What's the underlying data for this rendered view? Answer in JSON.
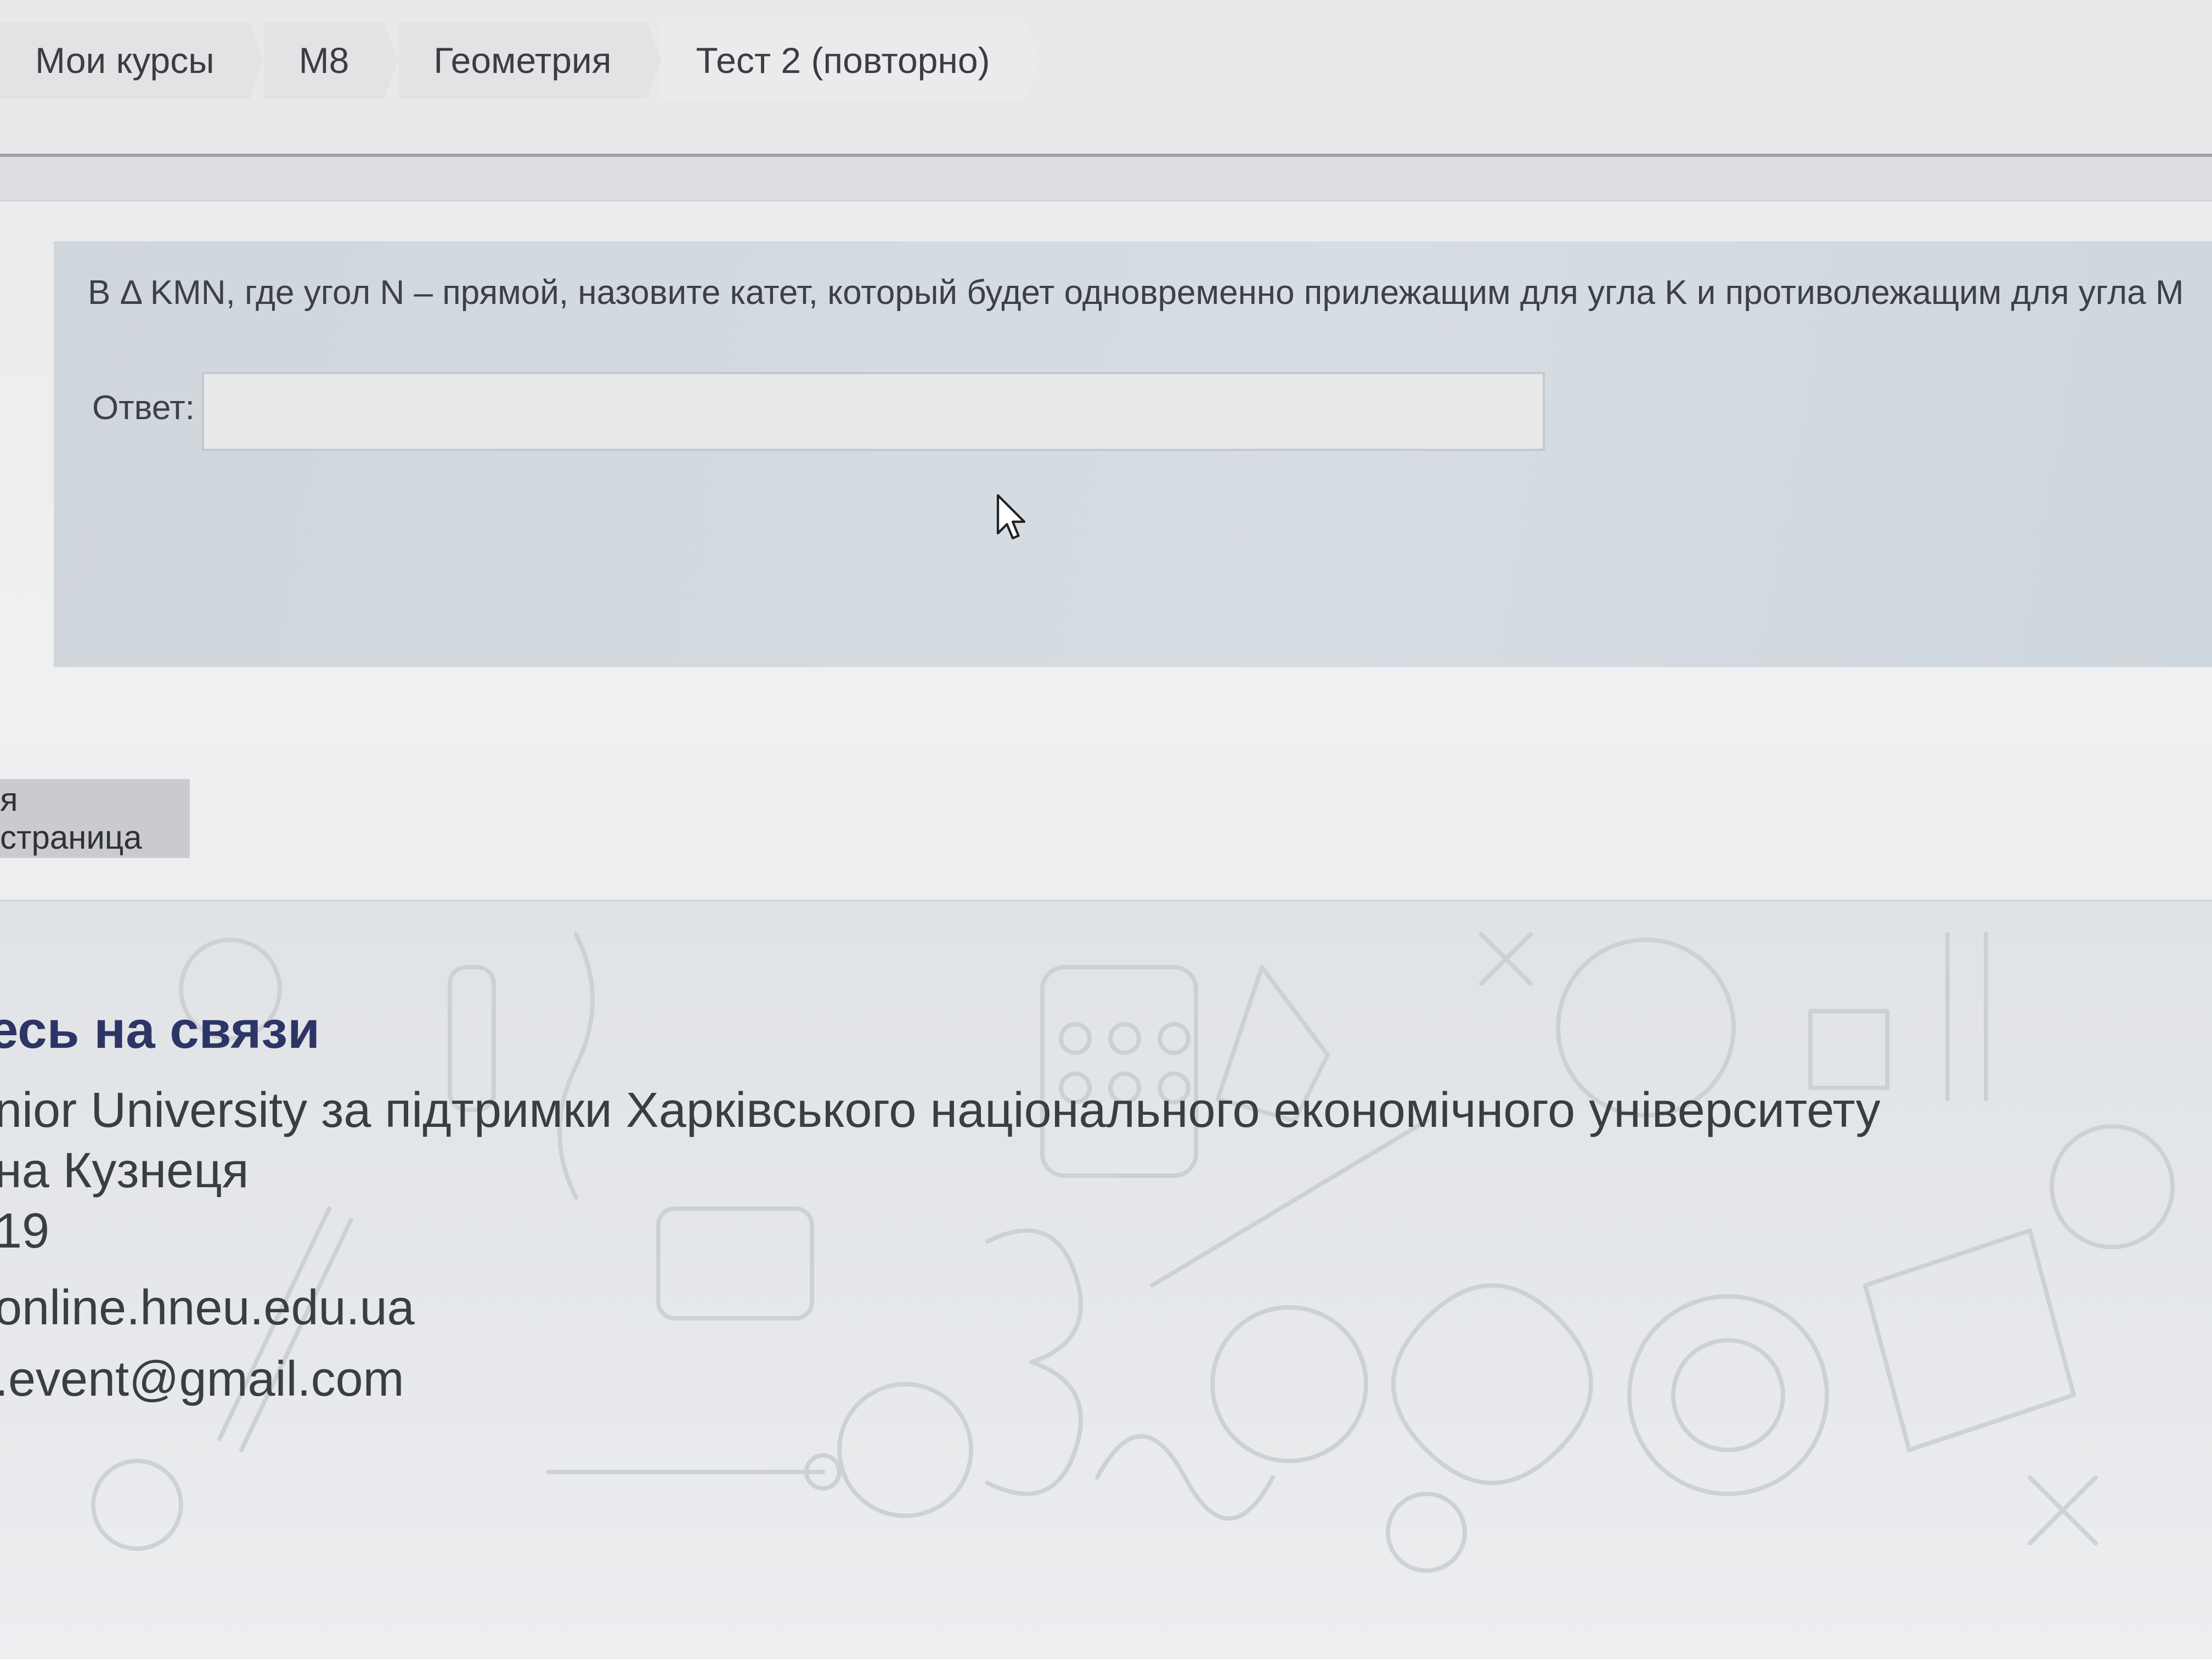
{
  "breadcrumb": {
    "items": [
      "Мои курсы",
      "М8",
      "Геометрия",
      "Тест 2 (повторно)"
    ]
  },
  "question": {
    "text": "В Δ KMN, где угол N – прямой, назовите катет, который будет одновременно прилежащим для угла K и противолежащим для угла M",
    "answer_label": "Ответ:",
    "answer_value": ""
  },
  "navigation": {
    "button_label": "я страница"
  },
  "footer": {
    "title": "есь на связи",
    "line1": "nior University за підтримки Харківського національного економічного університету",
    "line2": "на Кузнеця",
    "line3": "19",
    "website": "online.hneu.edu.ua",
    "email": ".event@gmail.com"
  },
  "colors": {
    "footer_title": "#2c3566",
    "question_bg": "#d3dbe1"
  }
}
